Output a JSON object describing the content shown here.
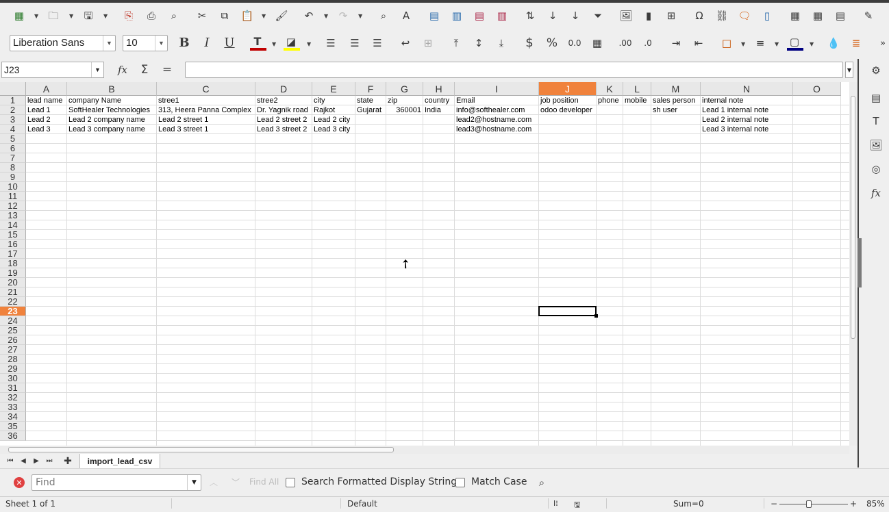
{
  "toolbar": {
    "font_name": "Liberation Sans",
    "font_size": "10",
    "text_color": "#c00000",
    "highlight_color": "#ffff00",
    "border_color": "#c75000",
    "bg_color": "#000080"
  },
  "formula_bar": {
    "name_box": "J23",
    "formula": ""
  },
  "columns": [
    {
      "letter": "A"
    },
    {
      "letter": "B"
    },
    {
      "letter": "C"
    },
    {
      "letter": "D"
    },
    {
      "letter": "E"
    },
    {
      "letter": "F"
    },
    {
      "letter": "G"
    },
    {
      "letter": "H"
    },
    {
      "letter": "I"
    },
    {
      "letter": "J",
      "selected": true
    },
    {
      "letter": "K"
    },
    {
      "letter": "L"
    },
    {
      "letter": "M"
    },
    {
      "letter": "N"
    },
    {
      "letter": "O"
    }
  ],
  "rows": [
    "1",
    "2",
    "3",
    "4",
    "5",
    "6",
    "7",
    "8",
    "9",
    "10",
    "11",
    "12",
    "13",
    "14",
    "15",
    "16",
    "17",
    "18",
    "19",
    "20",
    "21",
    "22",
    "23",
    "24",
    "25",
    "26",
    "27",
    "28",
    "29",
    "30",
    "31",
    "32",
    "33",
    "34",
    "35",
    "36"
  ],
  "selected_row": "23",
  "cells": [
    [
      "lead name",
      "company Name",
      "stree1",
      "stree2",
      "city",
      "state",
      "zip",
      "country",
      "Email",
      "job position",
      "phone",
      "mobile",
      "sales person",
      "internal note",
      ""
    ],
    [
      "Lead 1",
      "SoftHealer Technologies",
      "313, Heera Panna Complex",
      "Dr. Yagnik road",
      "Rajkot",
      "Gujarat",
      "360001",
      "India",
      "info@softhealer.com",
      "odoo developer",
      "",
      "",
      "sh user",
      "Lead 1 internal note",
      ""
    ],
    [
      "Lead 2",
      "Lead 2 company name",
      "Lead 2 street 1",
      "Lead 2 street 2",
      "Lead 2 city",
      "",
      "",
      "",
      "lead2@hostname.com",
      "",
      "",
      "",
      "",
      "Lead 2 internal note",
      ""
    ],
    [
      "Lead 3",
      "Lead 3 company name",
      "Lead 3 street 1",
      "Lead 3 street 2",
      "Lead 3 city",
      "",
      "",
      "",
      "lead3@hostname.com",
      "",
      "",
      "",
      "",
      "Lead 3 internal note",
      ""
    ]
  ],
  "sheet_tab": "import_lead_csv",
  "find_bar": {
    "placeholder": "Find",
    "find_all": "Find All",
    "search_formatted": "Search Formatted Display String",
    "match_case": "Match Case"
  },
  "status": {
    "sheet": "Sheet 1 of 1",
    "style": "Default",
    "sum": "Sum=0",
    "zoom": "85%"
  }
}
